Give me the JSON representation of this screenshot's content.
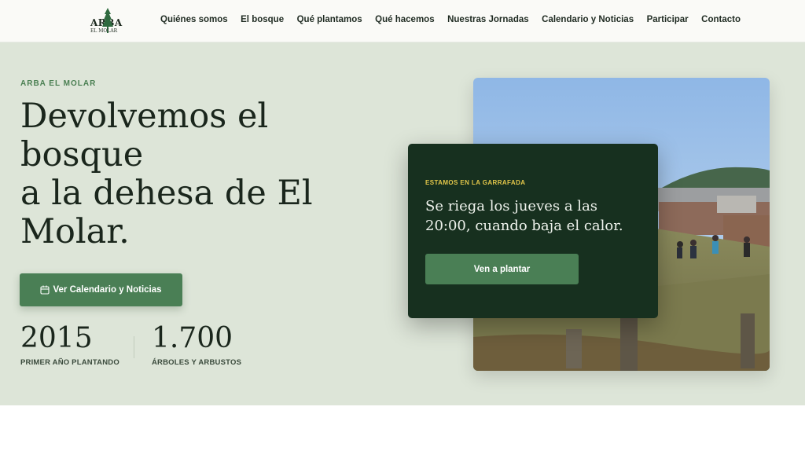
{
  "header": {
    "logo": {
      "text": "ARBA",
      "subtext": "EL MOLAR",
      "tree_color": "#2f6a3f"
    },
    "nav": [
      {
        "label": "Quiénes somos"
      },
      {
        "label": "El bosque"
      },
      {
        "label": "Qué plantamos"
      },
      {
        "label": "Qué hacemos"
      },
      {
        "label": "Nuestras Jornadas"
      },
      {
        "label": "Calendario y Noticias"
      },
      {
        "label": "Participar"
      },
      {
        "label": "Contacto"
      }
    ]
  },
  "hero": {
    "eyebrow": "ARBA EL MOLAR",
    "title_lines": [
      "Devolvemos el",
      "bosque",
      "a la dehesa de El",
      "Molar."
    ],
    "cta": {
      "label": "Ver Calendario y Noticias",
      "icon": "calendar-icon"
    },
    "stats": [
      {
        "value": "2015",
        "label": "PRIMER AÑO PLANTANDO"
      },
      {
        "value": "1.700",
        "label": "ÁRBOLES Y ARBUSTOS"
      }
    ]
  },
  "card": {
    "eyebrow": "ESTAMOS EN LA GARRAFADA",
    "text": "Se riega los jueves a las 20:00, cuando baja el calor.",
    "button": "Ven a plantar"
  },
  "colors": {
    "hero_bg": "#dde5d8",
    "accent_green": "#4a7f55",
    "card_bg": "#17301f",
    "card_eyebrow": "#e3c74a"
  }
}
